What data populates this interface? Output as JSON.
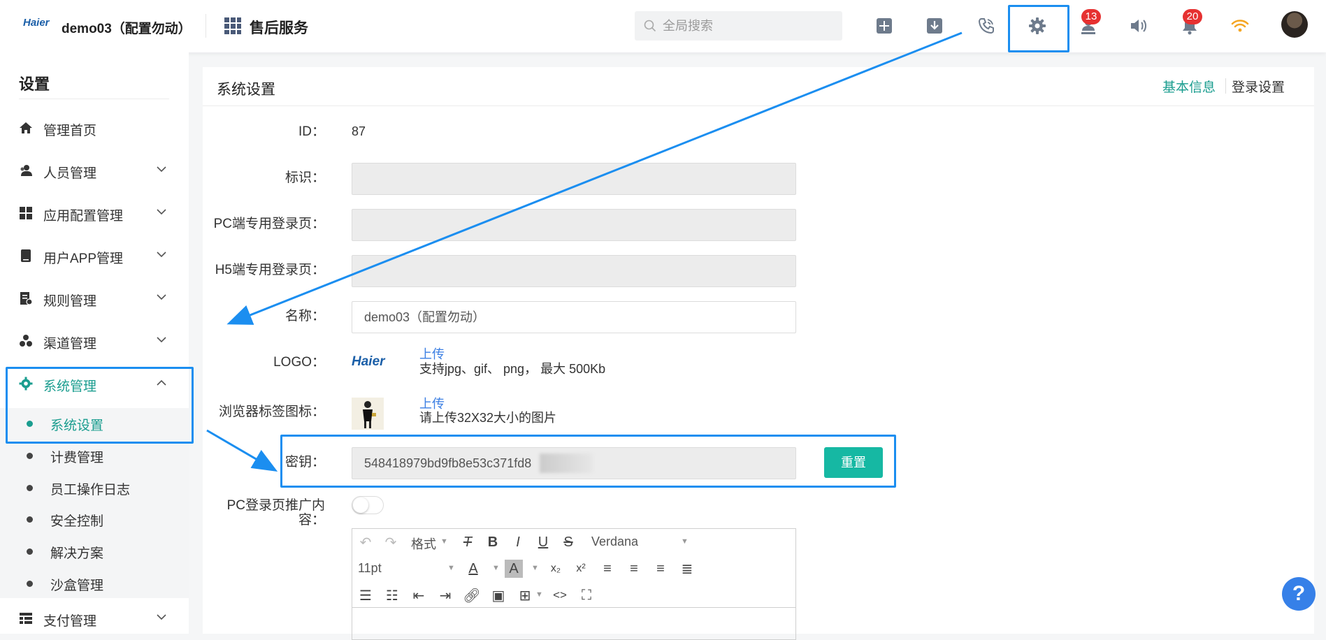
{
  "header": {
    "logo_text": "Haier",
    "org_name": "demo03（配置勿动）",
    "app_title": "售后服务",
    "search_placeholder": "全局搜索",
    "badges": {
      "tasks": "13",
      "notifications": "20"
    },
    "icons": [
      "add-icon",
      "download-icon",
      "phone-icon",
      "gear-icon",
      "user-task-icon",
      "speaker-icon",
      "bell-icon",
      "wifi-icon"
    ]
  },
  "sidebar": {
    "title": "设置",
    "items": [
      {
        "label": "管理首页",
        "icon": "home-icon"
      },
      {
        "label": "人员管理",
        "icon": "users-icon"
      },
      {
        "label": "应用配置管理",
        "icon": "grid-icon"
      },
      {
        "label": "用户APP管理",
        "icon": "phone-app-icon"
      },
      {
        "label": "规则管理",
        "icon": "rules-icon"
      },
      {
        "label": "渠道管理",
        "icon": "channel-icon"
      },
      {
        "label": "系统管理",
        "icon": "gear-icon"
      },
      {
        "label": "支付管理",
        "icon": "payment-icon"
      }
    ],
    "sub_items": [
      "系统设置",
      "计费管理",
      "员工操作日志",
      "安全控制",
      "解决方案",
      "沙盒管理"
    ]
  },
  "panel": {
    "title": "系统设置",
    "tabs": [
      "基本信息",
      "登录设置"
    ],
    "fields": {
      "id_label": "ID：",
      "id_value": "87",
      "tag_label": "标识：",
      "pc_login_label": "PC端专用登录页：",
      "h5_login_label": "H5端专用登录页：",
      "name_label": "名称：",
      "name_value": "demo03（配置勿动）",
      "logo_label": "LOGO：",
      "logo_text": "Haier",
      "logo_upload": "上传",
      "logo_hint": "支持jpg、gif、 png， 最大 500Kb",
      "favicon_label": "浏览器标签图标：",
      "favicon_upload": "上传",
      "favicon_hint": "请上传32X32大小的图片",
      "secret_label": "密钥：",
      "secret_value": "548418979bd9fb8e53c371fd8",
      "reset_button": "重置",
      "pc_promo_label_1": "PC登录页推广内",
      "pc_promo_label_2": "容：",
      "pc_promo_enabled": false
    },
    "editor": {
      "format_label": "格式",
      "font_family": "Verdana",
      "font_size": "11pt"
    }
  },
  "help_label": "?",
  "colors": {
    "accent": "#1a9d8f",
    "highlight": "#1b8ef0",
    "badge": "#e63131",
    "reset": "#16b8a3",
    "link": "#3a7ee3"
  }
}
